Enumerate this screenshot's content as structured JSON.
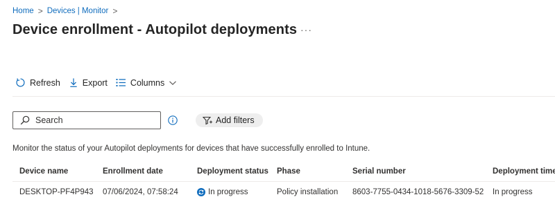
{
  "breadcrumb": [
    {
      "label": "Home"
    },
    {
      "label": "Devices | Monitor"
    }
  ],
  "breadcrumb_separator": ">",
  "page": {
    "title": "Device enrollment - Autopilot deployments",
    "more_label": "···"
  },
  "toolbar": {
    "refresh_label": "Refresh",
    "export_label": "Export",
    "columns_label": "Columns"
  },
  "search": {
    "placeholder": "Search"
  },
  "filters": {
    "add_label": "Add filters"
  },
  "description": "Monitor the status of your Autopilot deployments for devices that have successfully enrolled to Intune.",
  "grid": {
    "columns": [
      "Device name",
      "Enrollment date",
      "Deployment status",
      "Phase",
      "Serial number",
      "Deployment time"
    ],
    "rows": [
      {
        "device_name": "DESKTOP-PF4P943",
        "enrollment_date": "07/06/2024, 07:58:24",
        "deployment_status": "In progress",
        "phase": "Policy installation",
        "serial_number": "8603-7755-0434-1018-5676-3309-52",
        "deployment_time": "In progress"
      }
    ]
  },
  "colors": {
    "accent": "#0f6cbd",
    "text": "#323130",
    "divider": "#edebe9"
  }
}
